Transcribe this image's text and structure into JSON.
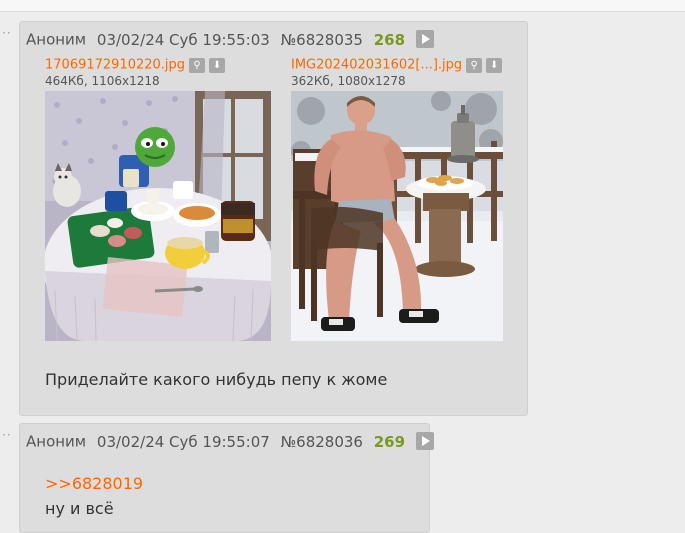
{
  "posts": [
    {
      "author": "Аноним",
      "date": "03/02/24 Суб 19:55:03",
      "number": "№6828035",
      "index": "268",
      "files": [
        {
          "name": "17069172910220.jpg",
          "meta": "464Кб, 1106x1218"
        },
        {
          "name": "IMG202402031602[...].jpg",
          "meta": "362Кб, 1080x1278"
        }
      ],
      "text": "Приделайте какого нибудь пепу к жоме"
    },
    {
      "author": "Аноним",
      "date": "03/02/24 Суб 19:55:07",
      "number": "№6828036",
      "index": "269",
      "reply_link": ">>6828019",
      "text": "ну и всё"
    }
  ],
  "icons": {
    "expand": "play-icon",
    "search": "magnifier-icon",
    "download": "download-icon"
  },
  "colors": {
    "link": "#ff6600",
    "index": "#789922",
    "post_bg": "#dddddd",
    "page_bg": "#ededed"
  }
}
